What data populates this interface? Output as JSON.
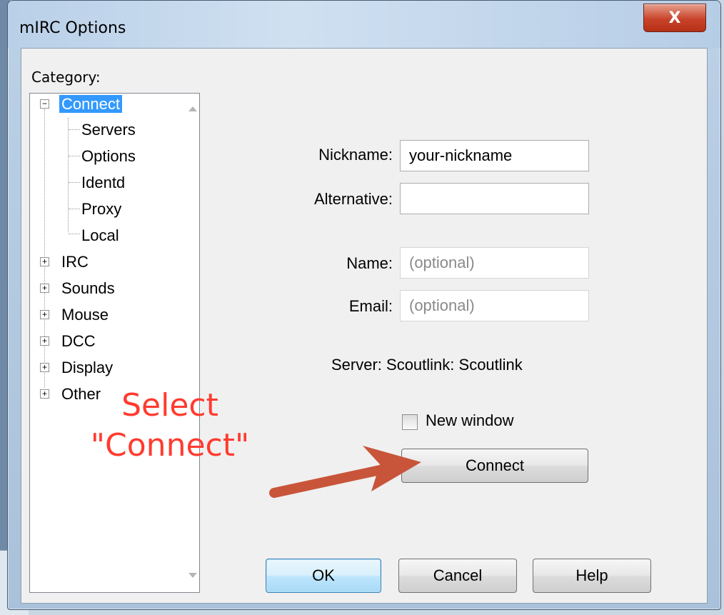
{
  "window": {
    "title": "mIRC Options",
    "close_symbol": "X"
  },
  "category": {
    "label": "Category:",
    "tree": [
      {
        "label": "Connect",
        "expander": "−",
        "selected": true
      },
      {
        "label": "Servers"
      },
      {
        "label": "Options"
      },
      {
        "label": "Identd"
      },
      {
        "label": "Proxy"
      },
      {
        "label": "Local"
      },
      {
        "label": "IRC",
        "expander": "+"
      },
      {
        "label": "Sounds",
        "expander": "+"
      },
      {
        "label": "Mouse",
        "expander": "+"
      },
      {
        "label": "DCC",
        "expander": "+"
      },
      {
        "label": "Display",
        "expander": "+"
      },
      {
        "label": "Other",
        "expander": "+"
      }
    ]
  },
  "form": {
    "nickname_label": "Nickname:",
    "nickname_value": "your-nickname",
    "alternative_label": "Alternative:",
    "alternative_value": "",
    "name_label": "Name:",
    "name_placeholder": "(optional)",
    "email_label": "Email:",
    "email_placeholder": "(optional)",
    "server_text": "Server: Scoutlink: Scoutlink",
    "new_window_label": "New window",
    "new_window_checked": false,
    "connect_label": "Connect"
  },
  "buttons": {
    "ok": "OK",
    "cancel": "Cancel",
    "help": "Help"
  },
  "annotation": {
    "line1": "Select",
    "line2": "\"Connect\"",
    "color": "#ff3b2f",
    "arrow_color": "#c8553a"
  }
}
